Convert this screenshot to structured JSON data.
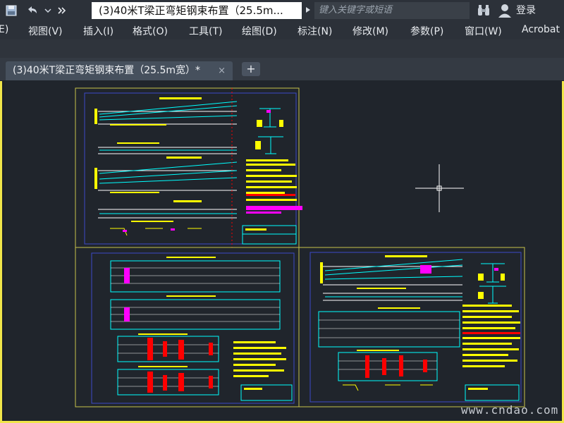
{
  "window": {
    "doc_title": "(3)40米T梁正弯矩钢束布置（25.5m...",
    "search_placeholder": "键入关键字或短语",
    "login_label": "登录"
  },
  "menu": {
    "items": [
      "E)",
      "视图(V)",
      "插入(I)",
      "格式(O)",
      "工具(T)",
      "绘图(D)",
      "标注(N)",
      "修改(M)",
      "参数(P)",
      "窗口(W)",
      "Acrobat"
    ]
  },
  "tabs": {
    "active_label": "(3)40米T梁正弯矩钢束布置（25.5m宽）*",
    "close_glyph": "×",
    "add_glyph": "+"
  },
  "icons": {
    "qa_save": "save-icon",
    "qa_undo": "undo-icon",
    "qa_dropdown": "chevron-down-icon",
    "qa_more": "double-chevron-right-icon",
    "title_more": "triangle-right-icon",
    "search": "binoculars-icon",
    "user": "user-icon"
  },
  "colors": {
    "accent_frame": "#f0e64a",
    "drawing_yellow": "#ffff00",
    "drawing_cyan": "#00ffff",
    "drawing_magenta": "#ff00ff",
    "drawing_red": "#ff0000",
    "drawing_white": "#ffffff",
    "canvas_bg": "#20252c"
  },
  "watermark": "www.cndao.com"
}
